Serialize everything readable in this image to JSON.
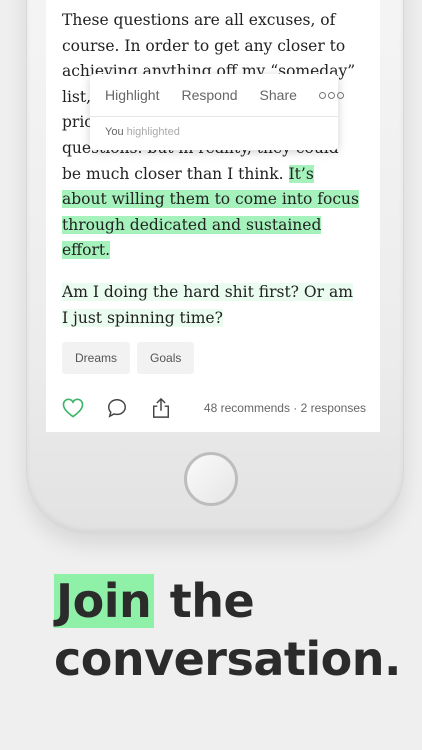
{
  "article": {
    "para1_before": "These questions are all excuses, of course. In order to get any closer to achieving anything off my “someday” list, I need to make these things a priority instead of avoiding these questions. ",
    "para1_visible_fragment": "but in reality, they could be much closer than I think. ",
    "para1_highlight": "It’s about willing them to come into focus through dedicated and sustained effort.",
    "para2": "Am I doing the hard shit first? Or am I just spinning time?"
  },
  "popover": {
    "actions": [
      "Highlight",
      "Respond",
      "Share"
    ],
    "more_icon": "more-icon",
    "meta_who": "You",
    "meta_action": "highlighted"
  },
  "tags": [
    "Dreams",
    "Goals"
  ],
  "footer": {
    "stats": "48 recommends · 2 responses",
    "icons": [
      "heart-icon",
      "comment-icon",
      "share-icon"
    ]
  },
  "headline": {
    "highlight_word": "Join",
    "rest_line1": " the",
    "line2": "conversation."
  },
  "colors": {
    "highlight": "#a5f2bc",
    "highlight_light": "#eafbef",
    "heart": "#3fb56a",
    "headline_highlight": "#8ff0a8"
  }
}
